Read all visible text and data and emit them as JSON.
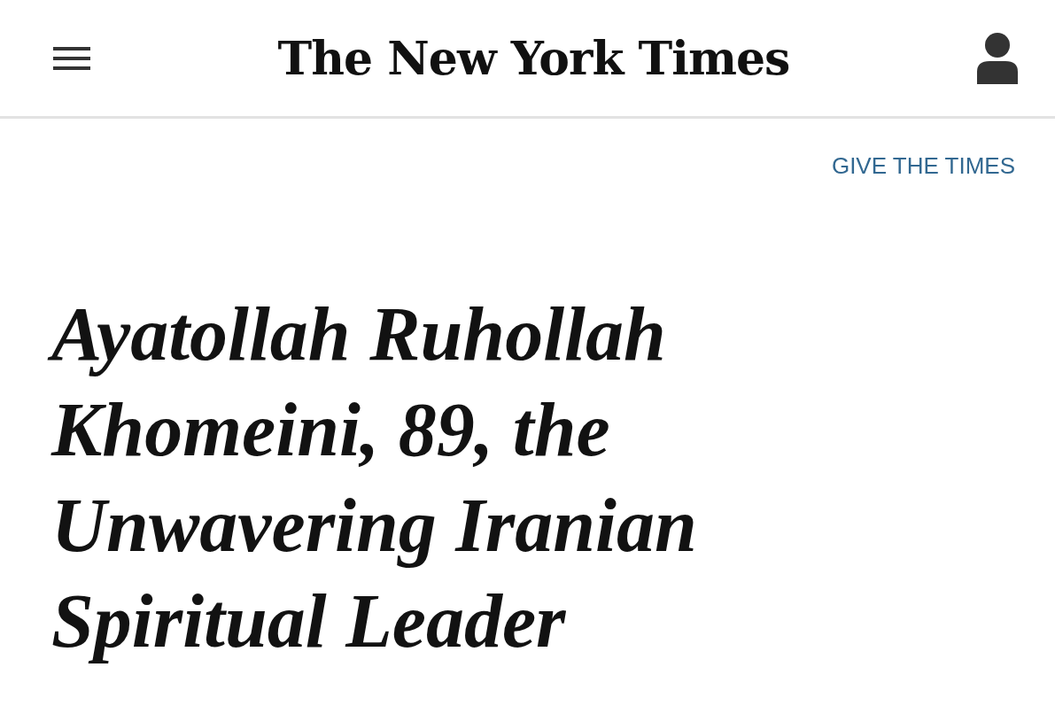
{
  "header": {
    "logo": "The New York Times"
  },
  "gift_link": "GIVE THE TIMES",
  "headline": "Ayatollah Ruhollah Khomeini, 89, the Unwavering Iranian Spiritual Leader"
}
